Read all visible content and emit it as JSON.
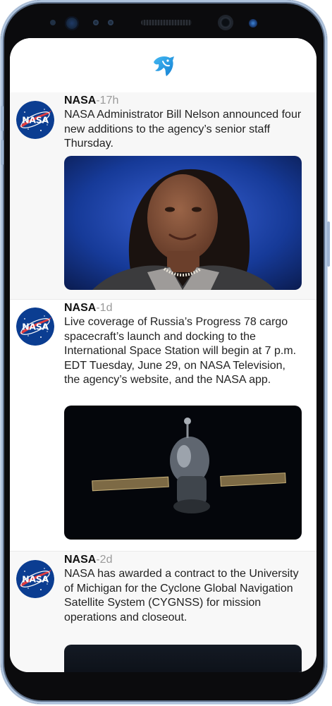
{
  "app": {
    "logo_icon": "bird-logo-icon",
    "accent": "#1da1f2"
  },
  "posts": [
    {
      "author": "NASA",
      "time": "-17h",
      "text": "NASA Administrator Bill Nelson announced four new additions to the agency’s senior staff Thursday.",
      "avatar_icon": "nasa-meatball-logo",
      "media_icon": "portrait-photo"
    },
    {
      "author": "NASA",
      "time": "-1d",
      "text": "Live coverage of Russia’s Progress 78 cargo spacecraft’s launch and docking to the International Space Station will begin at 7 p.m. EDT Tuesday, June 29, on NASA Television, the agency’s website, and the NASA app.",
      "avatar_icon": "nasa-meatball-logo",
      "media_icon": "spacecraft-photo"
    },
    {
      "author": "NASA",
      "time": "-2d",
      "text": "NASA has awarded a contract to the University of Michigan for the Cyclone Global Navigation Satellite System (CYGNSS) for mission operations and closeout.",
      "avatar_icon": "nasa-meatball-logo",
      "media_icon": "space-photo"
    }
  ]
}
